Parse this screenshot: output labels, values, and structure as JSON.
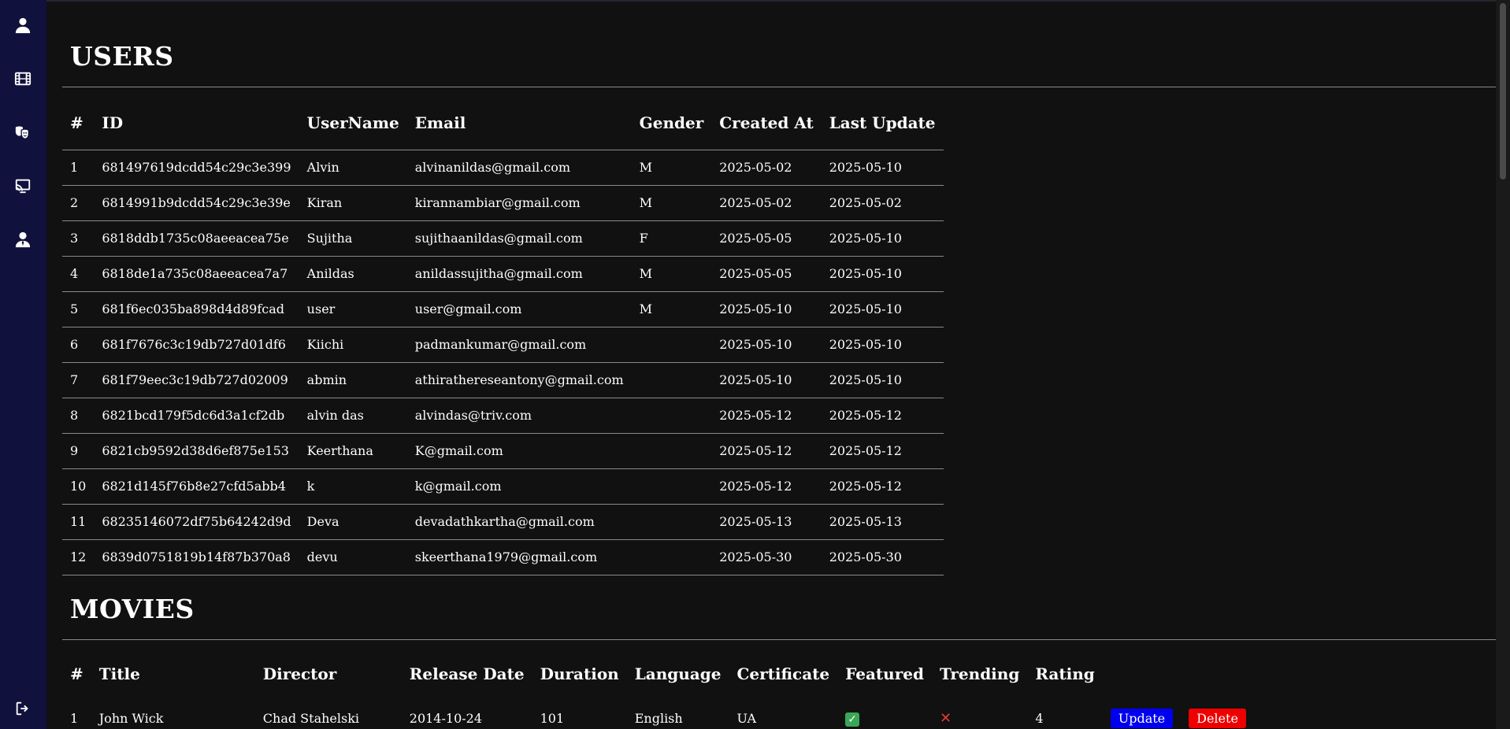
{
  "sidebar": {
    "icons": [
      "user-icon",
      "film-icon",
      "theater-masks-icon",
      "cast-screen-icon",
      "user-tie-icon",
      "logout-icon"
    ]
  },
  "users": {
    "title": "USERS",
    "headers": [
      "#",
      "ID",
      "UserName",
      "Email",
      "Gender",
      "Created At",
      "Last Update"
    ],
    "rows": [
      [
        "1",
        "681497619dcdd54c29c3e399",
        "Alvin",
        "alvinanildas@gmail.com",
        "M",
        "2025-05-02",
        "2025-05-10"
      ],
      [
        "2",
        "6814991b9dcdd54c29c3e39e",
        "Kiran",
        "kirannambiar@gmail.com",
        "M",
        "2025-05-02",
        "2025-05-02"
      ],
      [
        "3",
        "6818ddb1735c08aeeacea75e",
        "Sujitha",
        "sujithaanildas@gmail.com",
        "F",
        "2025-05-05",
        "2025-05-10"
      ],
      [
        "4",
        "6818de1a735c08aeeacea7a7",
        "Anildas",
        "anildassujitha@gmail.com",
        "M",
        "2025-05-05",
        "2025-05-10"
      ],
      [
        "5",
        "681f6ec035ba898d4d89fcad",
        "user",
        "user@gmail.com",
        "M",
        "2025-05-10",
        "2025-05-10"
      ],
      [
        "6",
        "681f7676c3c19db727d01df6",
        "Kiichi",
        "padmankumar@gmail.com",
        "",
        "2025-05-10",
        "2025-05-10"
      ],
      [
        "7",
        "681f79eec3c19db727d02009",
        "abmin",
        "athirathereseantony@gmail.com",
        "",
        "2025-05-10",
        "2025-05-10"
      ],
      [
        "8",
        "6821bcd179f5dc6d3a1cf2db",
        "alvin das",
        "alvindas@triv.com",
        "",
        "2025-05-12",
        "2025-05-12"
      ],
      [
        "9",
        "6821cb9592d38d6ef875e153",
        "Keerthana",
        "K@gmail.com",
        "",
        "2025-05-12",
        "2025-05-12"
      ],
      [
        "10",
        "6821d145f76b8e27cfd5abb4",
        "k",
        "k@gmail.com",
        "",
        "2025-05-12",
        "2025-05-12"
      ],
      [
        "11",
        "68235146072df75b64242d9d",
        "Deva",
        "devadathkartha@gmail.com",
        "",
        "2025-05-13",
        "2025-05-13"
      ],
      [
        "12",
        "6839d0751819b14f87b370a8",
        "devu",
        "skeerthana1979@gmail.com",
        "",
        "2025-05-30",
        "2025-05-30"
      ]
    ]
  },
  "movies": {
    "title": "MOVIES",
    "headers": [
      "#",
      "Title",
      "Director",
      "Release Date",
      "Duration",
      "Language",
      "Certificate",
      "Featured",
      "Trending",
      "Rating"
    ],
    "rows": [
      {
        "num": "1",
        "title": "John Wick",
        "director": "Chad Stahelski",
        "release_date": "2014-10-24",
        "duration": "101",
        "language": "English",
        "certificate": "UA",
        "featured": true,
        "trending": false,
        "rating": "4",
        "update_label": "Update",
        "delete_label": "Delete"
      }
    ]
  },
  "colors": {
    "sidebar_bg": "#11113d",
    "page_bg": "#111111",
    "update_button": "#0000ee",
    "delete_button": "#ee0000"
  }
}
